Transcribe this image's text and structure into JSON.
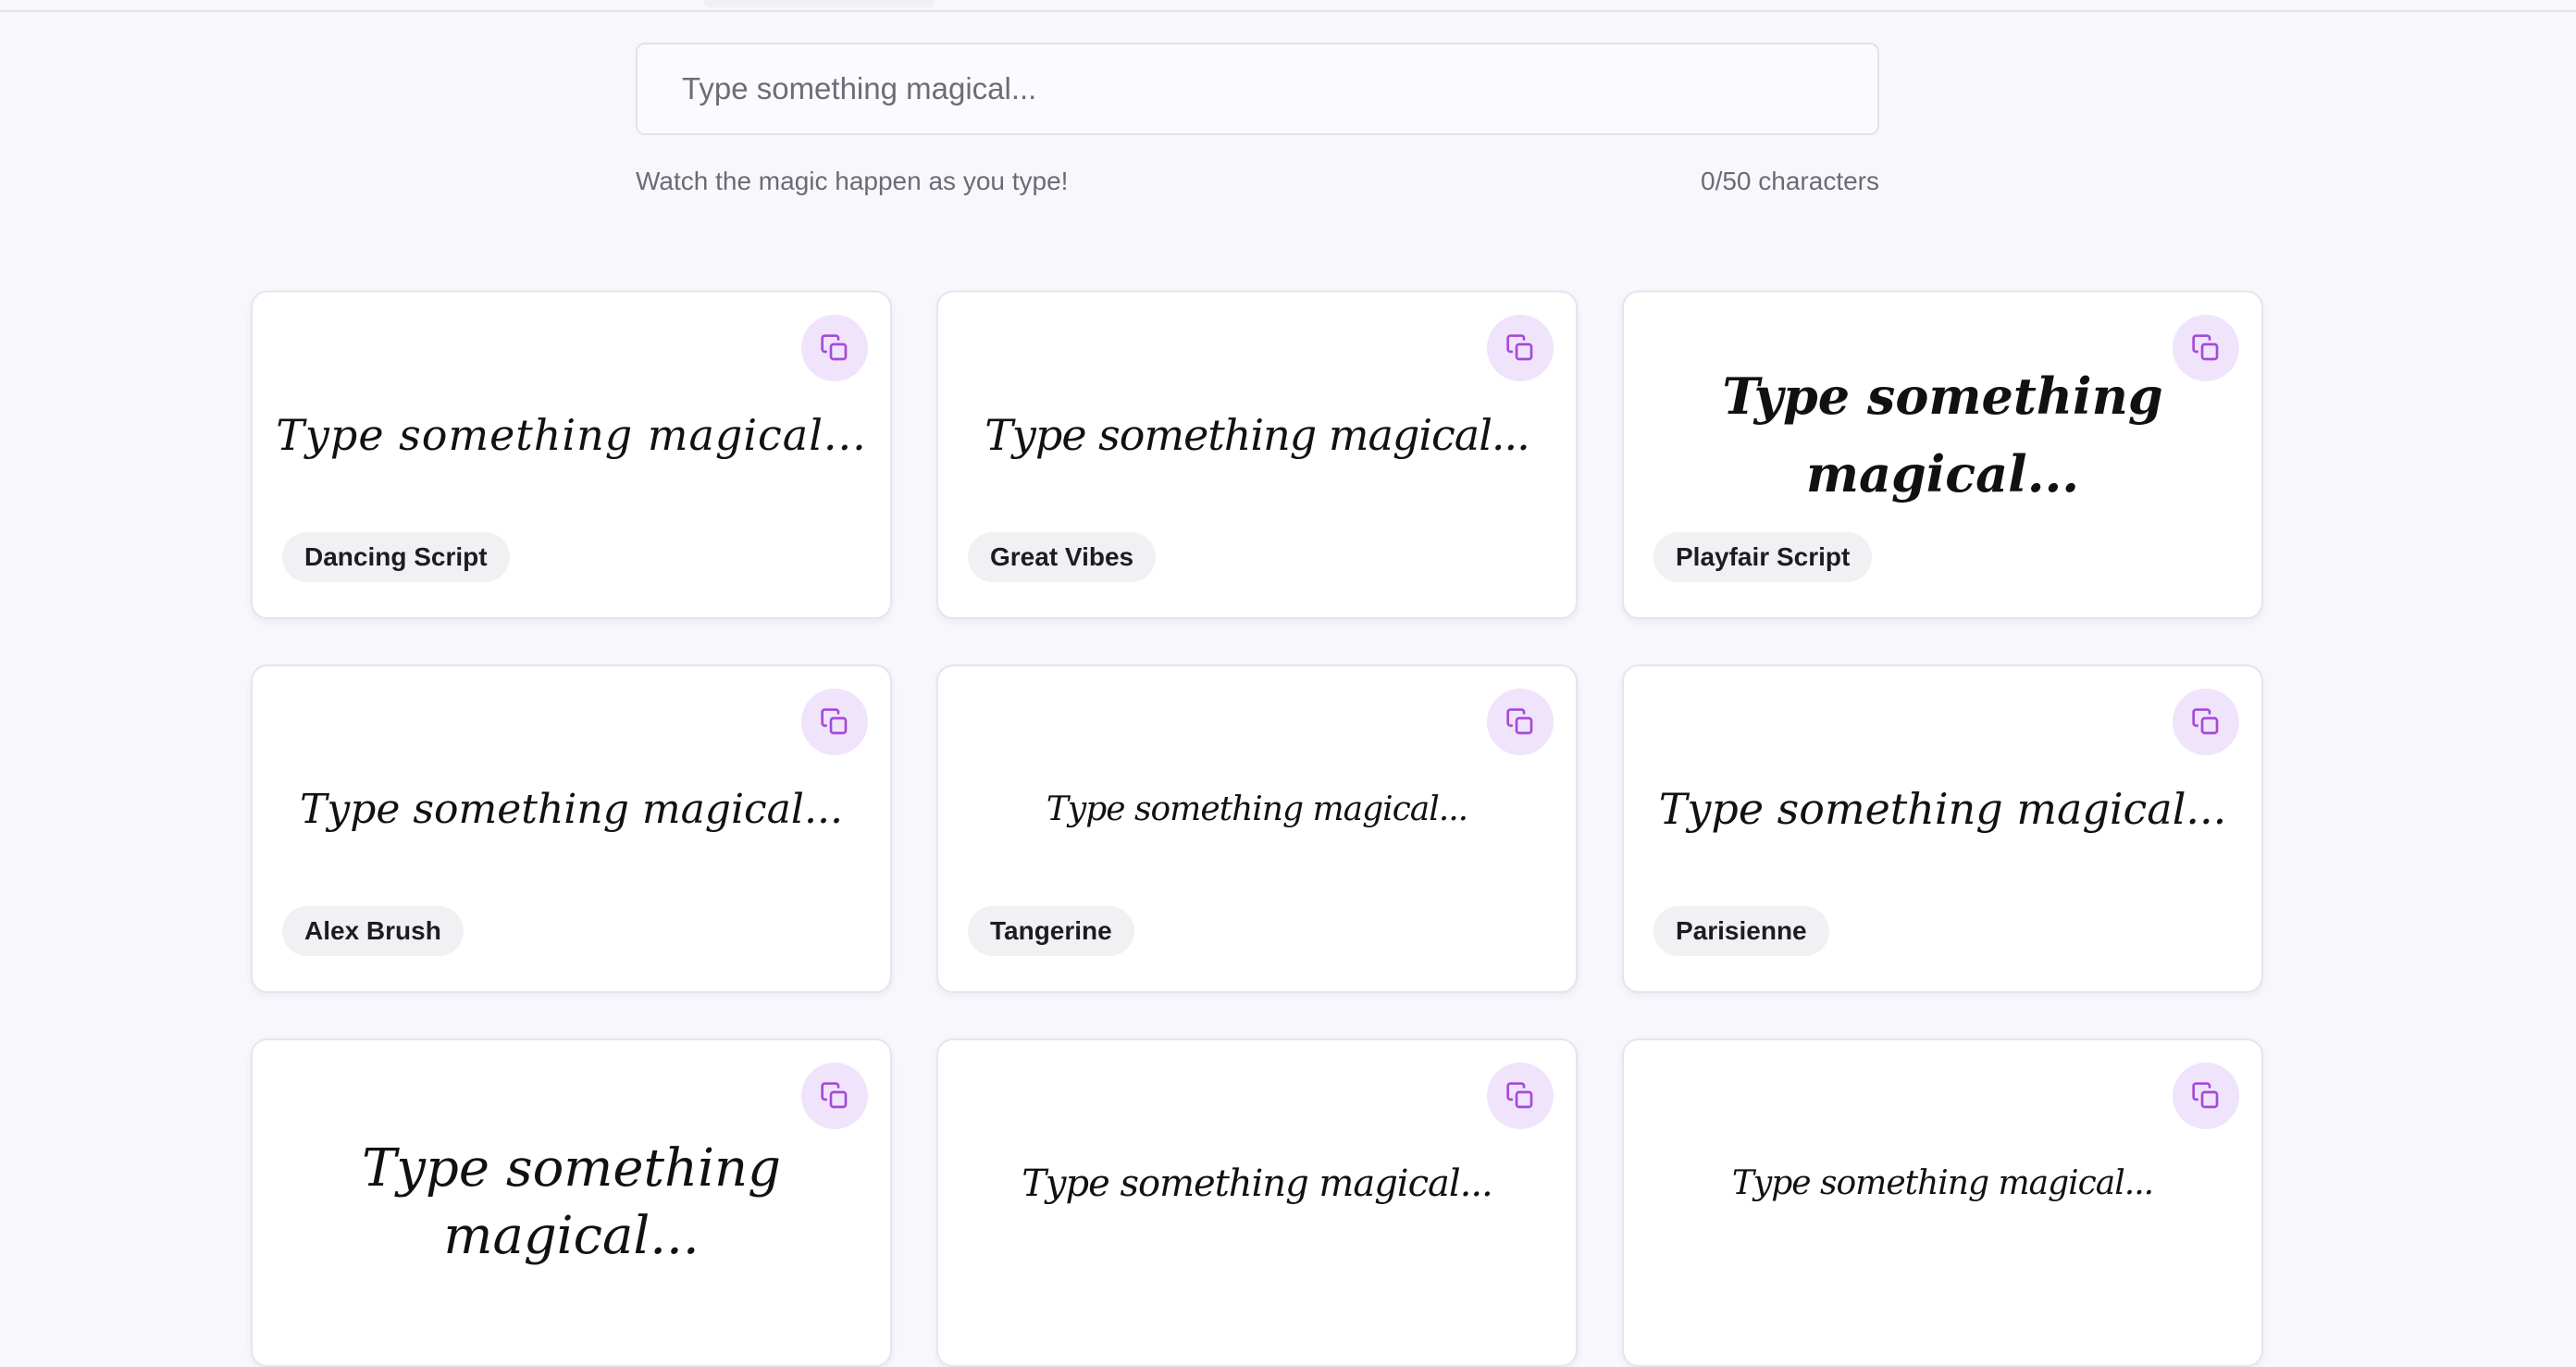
{
  "search": {
    "placeholder": "Type something magical...",
    "value": "",
    "helper": "Watch the magic happen as you type!",
    "counter": "0/50 characters"
  },
  "cards": [
    {
      "preview": "Type something magical...",
      "font_label": "Dancing Script",
      "copy_icon": "copy-icon"
    },
    {
      "preview": "Type something magical...",
      "font_label": "Great Vibes",
      "copy_icon": "copy-icon"
    },
    {
      "preview": "Type something magical...",
      "font_label": "Playfair Script",
      "copy_icon": "copy-icon"
    },
    {
      "preview": "Type something magical...",
      "font_label": "Alex Brush",
      "copy_icon": "copy-icon"
    },
    {
      "preview": "Type something magical...",
      "font_label": "Tangerine",
      "copy_icon": "copy-icon"
    },
    {
      "preview": "Type something magical...",
      "font_label": "Parisienne",
      "copy_icon": "copy-icon"
    },
    {
      "preview": "Type something magical...",
      "copy_icon": "copy-icon"
    },
    {
      "preview": "Type something magical...",
      "copy_icon": "copy-icon"
    },
    {
      "preview": "Type something magical...",
      "copy_icon": "copy-icon"
    }
  ],
  "colors": {
    "accent": "#a64ad9",
    "accent_bg": "#efe4fb",
    "page_bg": "#f8f7fc",
    "badge_bg": "#f1f0f3"
  }
}
